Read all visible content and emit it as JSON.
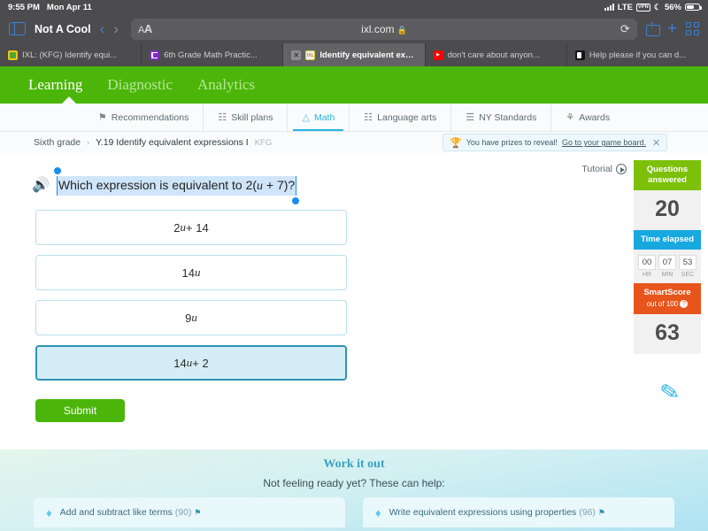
{
  "status_bar": {
    "time": "9:55 PM",
    "date": "Mon Apr 11",
    "network": "LTE",
    "vpn": "VPN",
    "dnd_icon": "moon-icon",
    "battery_percent": "56%"
  },
  "browser": {
    "window_title": "Not A Cool",
    "back_icon": "chevron-left-icon",
    "forward_icon": "chevron-right-icon",
    "text_size_label": "AA",
    "url": "ixl.com",
    "lock_icon": "lock-icon",
    "reload_icon": "reload-icon",
    "share_icon": "share-icon",
    "new_tab_icon": "plus-icon",
    "tabs_overview_icon": "tab-grid-icon",
    "tabs": [
      {
        "title": "IXL: (KFG) Identify equi...",
        "favicon": "ixl-green-icon",
        "active": false,
        "closable": false
      },
      {
        "title": "6th Grade Math Practic...",
        "favicon": "purple-doc-icon",
        "active": false,
        "closable": false
      },
      {
        "title": "Identify equivalent expr...",
        "favicon": "ixl-icon",
        "active": true,
        "closable": true,
        "close_label": "✕"
      },
      {
        "title": "don't care about anyon...",
        "favicon": "youtube-icon",
        "active": false,
        "closable": false
      },
      {
        "title": "Help please if you can d...",
        "favicon": "dark-app-icon",
        "active": false,
        "closable": false
      }
    ]
  },
  "ixl_nav": {
    "items": [
      {
        "label": "Learning",
        "active": true
      },
      {
        "label": "Diagnostic",
        "active": false
      },
      {
        "label": "Analytics",
        "active": false
      }
    ]
  },
  "subnav": {
    "items": [
      {
        "label": "Recommendations",
        "icon": "⚑",
        "active": false
      },
      {
        "label": "Skill plans",
        "icon": "☷",
        "active": false
      },
      {
        "label": "Math",
        "icon": "△",
        "active": true
      },
      {
        "label": "Language arts",
        "icon": "☷",
        "active": false
      },
      {
        "label": "NY Standards",
        "icon": "☰",
        "active": false
      },
      {
        "label": "Awards",
        "icon": "⚘",
        "active": false
      }
    ]
  },
  "breadcrumb": {
    "grade": "Sixth grade",
    "separator": "›",
    "skill": "Y.19 Identify equivalent expressions I",
    "code": "KFG"
  },
  "prize_banner": {
    "trophy_icon": "trophy-icon",
    "message": "You have prizes to reveal!",
    "link": "Go to your game board.",
    "close_label": "✕"
  },
  "question": {
    "tutorial_label": "Tutorial",
    "speaker_icon": "speaker-icon",
    "text_prefix": "Which expression is equivalent to 2(",
    "text_var": "u",
    "text_suffix": " + 7)?",
    "choices": [
      {
        "prefix": "2",
        "var": "u",
        "suffix": " + 14",
        "selected": false
      },
      {
        "prefix": "14",
        "var": "u",
        "suffix": "",
        "selected": false
      },
      {
        "prefix": "9",
        "var": "u",
        "suffix": "",
        "selected": false
      },
      {
        "prefix": "14",
        "var": "u",
        "suffix": " + 2",
        "selected": true
      }
    ],
    "submit_label": "Submit",
    "scratchpad_icon": "pencil-icon"
  },
  "score_panel": {
    "questions_answered_label": "Questions answered",
    "questions_answered_value": "20",
    "time_elapsed_label": "Time elapsed",
    "timer": [
      {
        "value": "00",
        "unit": "HR"
      },
      {
        "value": "07",
        "unit": "MIN"
      },
      {
        "value": "53",
        "unit": "SEC"
      }
    ],
    "smartscore_label": "SmartScore",
    "smartscore_sub": "out of 100",
    "help_icon": "question-mark-icon",
    "smartscore_value": "63"
  },
  "work_it_out": {
    "title": "Work it out",
    "subtitle": "Not feeling ready yet? These can help:",
    "cards": [
      {
        "gem_icon": "diamond-icon",
        "label": "Add and subtract like terms",
        "count": "(90)",
        "flag_icon": "⚑"
      },
      {
        "gem_icon": "diamond-icon",
        "label": "Write equivalent expressions using properties",
        "count": "(96)",
        "flag_icon": "⚑"
      }
    ]
  },
  "colors": {
    "ixl_green": "#4bb609",
    "accent_blue": "#2ab3e0",
    "smartscore_orange": "#e8551c",
    "selected_choice": "#d5edf7"
  }
}
